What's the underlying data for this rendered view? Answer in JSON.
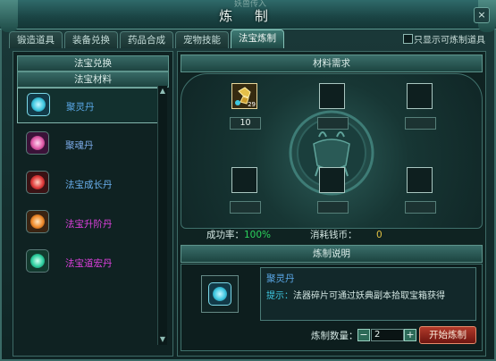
{
  "window": {
    "title": "炼 制",
    "top_caption": "妖兽传入",
    "close_label": "×"
  },
  "tabs": [
    {
      "label": "锻造道具",
      "active": false
    },
    {
      "label": "装备兑换",
      "active": false
    },
    {
      "label": "药品合成",
      "active": false
    },
    {
      "label": "宠物技能",
      "active": false
    },
    {
      "label": "法宝炼制",
      "active": true
    }
  ],
  "only_show_option": {
    "label": "只显示可炼制道具",
    "checked": false
  },
  "left": {
    "header1": "法宝兑换",
    "header2": "法宝材料",
    "items": [
      {
        "name": "聚灵丹",
        "color": "#5aa8e8",
        "orb": "#3ec7e0",
        "selected": true
      },
      {
        "name": "聚魂丹",
        "color": "#7aa9e6",
        "orb": "#e05aa8",
        "selected": false
      },
      {
        "name": "法宝成长丹",
        "color": "#6ab0ee",
        "orb": "#e03a3a",
        "selected": false
      },
      {
        "name": "法宝升阶丹",
        "color": "#e040e0",
        "orb": "#f08a2a",
        "selected": false
      },
      {
        "name": "法宝道宏丹",
        "color": "#e040e0",
        "orb": "#2ed0a0",
        "selected": false
      }
    ]
  },
  "materials": {
    "header": "材料需求",
    "slot1": {
      "icon": "gold-fragment-icon",
      "badge": "29",
      "count": "10"
    },
    "success_label": "成功率：",
    "success_value": "100%",
    "cost_label": "消耗钱币：",
    "cost_value": "0"
  },
  "description": {
    "header": "炼制说明",
    "item_name": "聚灵丹",
    "hint_label": "提示：",
    "hint_text": "法器碎片可通过妖典副本拾取宝箱获得"
  },
  "craft": {
    "quantity_label": "炼制数量：",
    "minus": "−",
    "plus": "+",
    "quantity": "2",
    "start_label": "开始炼制"
  }
}
